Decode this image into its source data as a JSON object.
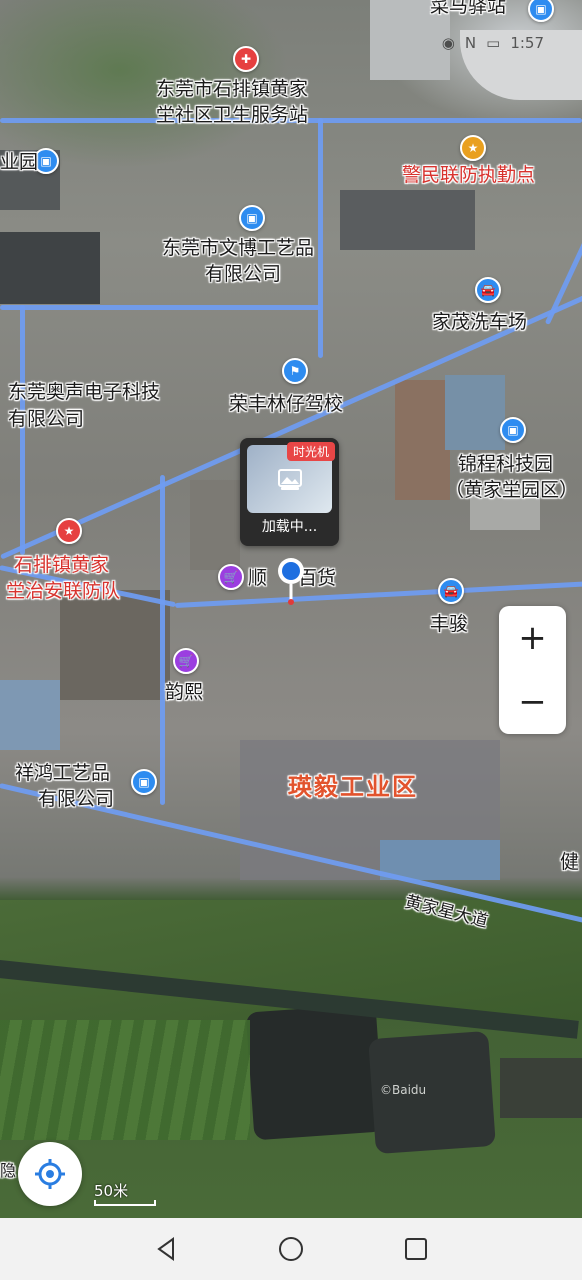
{
  "status_bar": {
    "time": "1:57"
  },
  "map": {
    "labels": {
      "top_station": "菜马驿站",
      "clinic_l1": "东莞市石排镇黄家",
      "clinic_l2": "坣社区卫生服务站",
      "park_partial": "业园",
      "police": "警民联防执勤点",
      "wenbo_l1": "东莞市文博工艺品",
      "wenbo_l2": "有限公司",
      "carwash": "家茂洗车场",
      "aosheng_l1": "东莞奥声电子科技",
      "aosheng_l2": "有限公司",
      "driving_school": "荣丰林仔驾校",
      "jincheng_l1": "锦程科技园",
      "jincheng_l2": "（黄家坣园区）",
      "security_l1": "石排镇黄家",
      "security_l2": "坣治安联防队",
      "shun_store": "顺",
      "shun_store_tail": "百货",
      "fengjun": "丰骏",
      "yunxi": "韵熙",
      "xianghong_l1": "祥鸿工艺品",
      "xianghong_l2": "有限公司",
      "industrial_zone": "瑛毅工业区",
      "jian_partial": "健",
      "road_name": "黄家星大道",
      "baidu_mark": "©Baidu",
      "road_partial": "隐"
    }
  },
  "time_machine": {
    "badge": "时光机",
    "loading": "加载中..."
  },
  "zoom": {
    "in": "+",
    "out": "−"
  },
  "scale": {
    "label": "50米"
  },
  "colors": {
    "road": "#6f9cf2",
    "poi_blue": "#2e8cf0",
    "poi_purple": "#9b3ee0",
    "poi_red": "#e64040",
    "label_red": "#d8332e",
    "zone_orange": "#e2532d"
  },
  "icons": {
    "locate": "locate-target-icon",
    "back": "nav-back-icon",
    "home": "nav-home-icon",
    "recents": "nav-recents-icon"
  }
}
